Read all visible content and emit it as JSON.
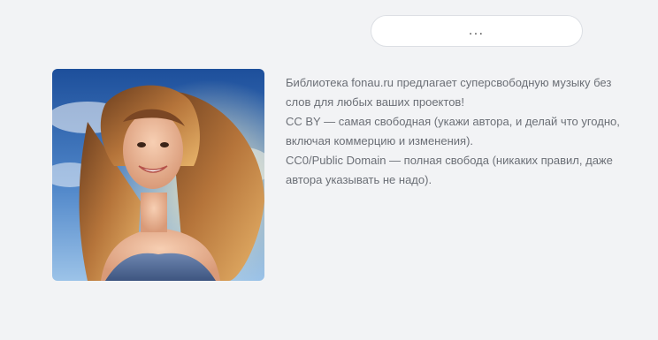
{
  "more_button": {
    "label": "..."
  },
  "album_cover": {
    "alt": "Smiling woman with long flowing hair against a blue sky"
  },
  "description": {
    "lines": [
      "Библиотека fonau.ru предлагает суперсвободную музыку без слов для любых ваших проектов!",
      "CC BY — самая свободная (укажи автора, и делай что угодно, включая коммерцию и изменения).",
      "CC0/Public Domain — полная свобода (никаких правил, даже автора указывать не надо)."
    ]
  },
  "colors": {
    "background": "#f2f3f5",
    "text": "#6b6f76",
    "button_bg": "#ffffff",
    "button_border": "#dcdfe4"
  }
}
